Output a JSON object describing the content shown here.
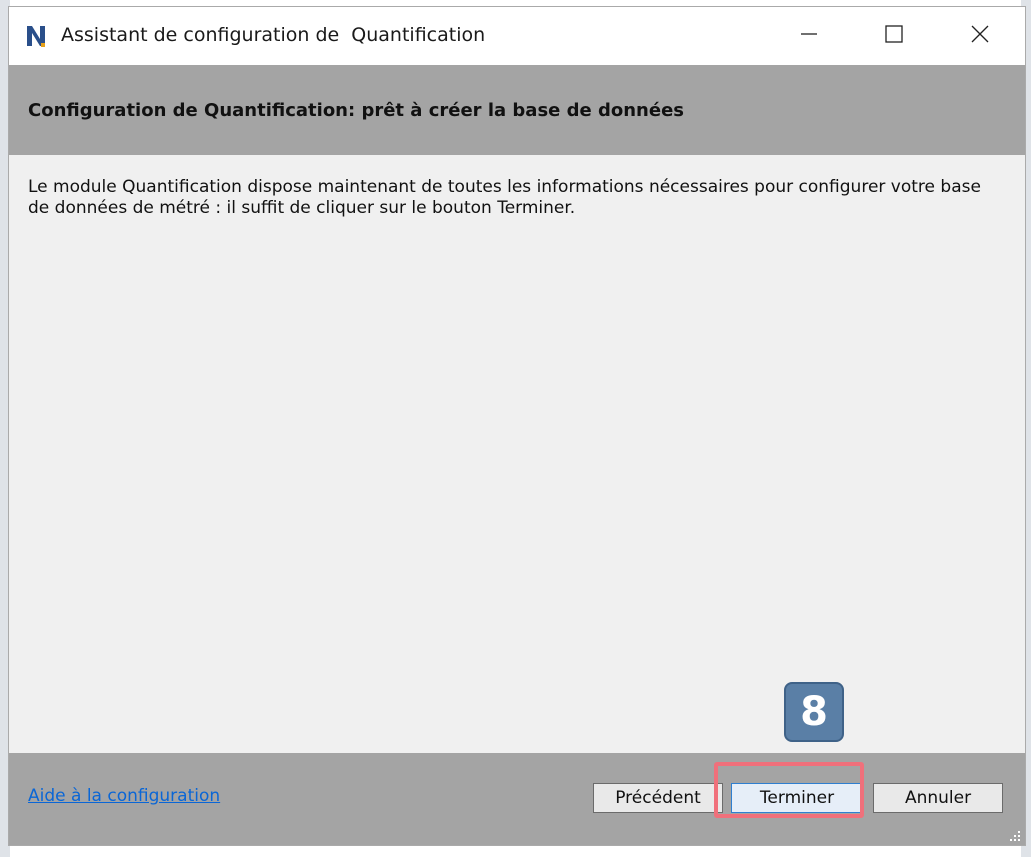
{
  "window": {
    "title": "Assistant de configuration de  Quantification",
    "icon": "app-n-icon",
    "controls": [
      "minimize-icon",
      "maximize-icon",
      "close-icon"
    ]
  },
  "header": {
    "title": "Configuration de Quantification: prêt à créer la base de données"
  },
  "content": {
    "message": "Le module Quantification dispose maintenant de toutes les informations nécessaires pour configurer votre base de données de métré : il suffit de cliquer sur le bouton Terminer."
  },
  "footer": {
    "help_link": "Aide à la configuration",
    "buttons": {
      "previous": "Précédent",
      "finish": "Terminer",
      "cancel": "Annuler"
    }
  },
  "annotation": {
    "step_number": "8",
    "highlight_color": "#f0707b",
    "badge_color": "#5a7fa6"
  },
  "colors": {
    "band_gray": "#a4a4a4",
    "body_bg": "#f0f0f0",
    "link_blue": "#0a66d6"
  }
}
